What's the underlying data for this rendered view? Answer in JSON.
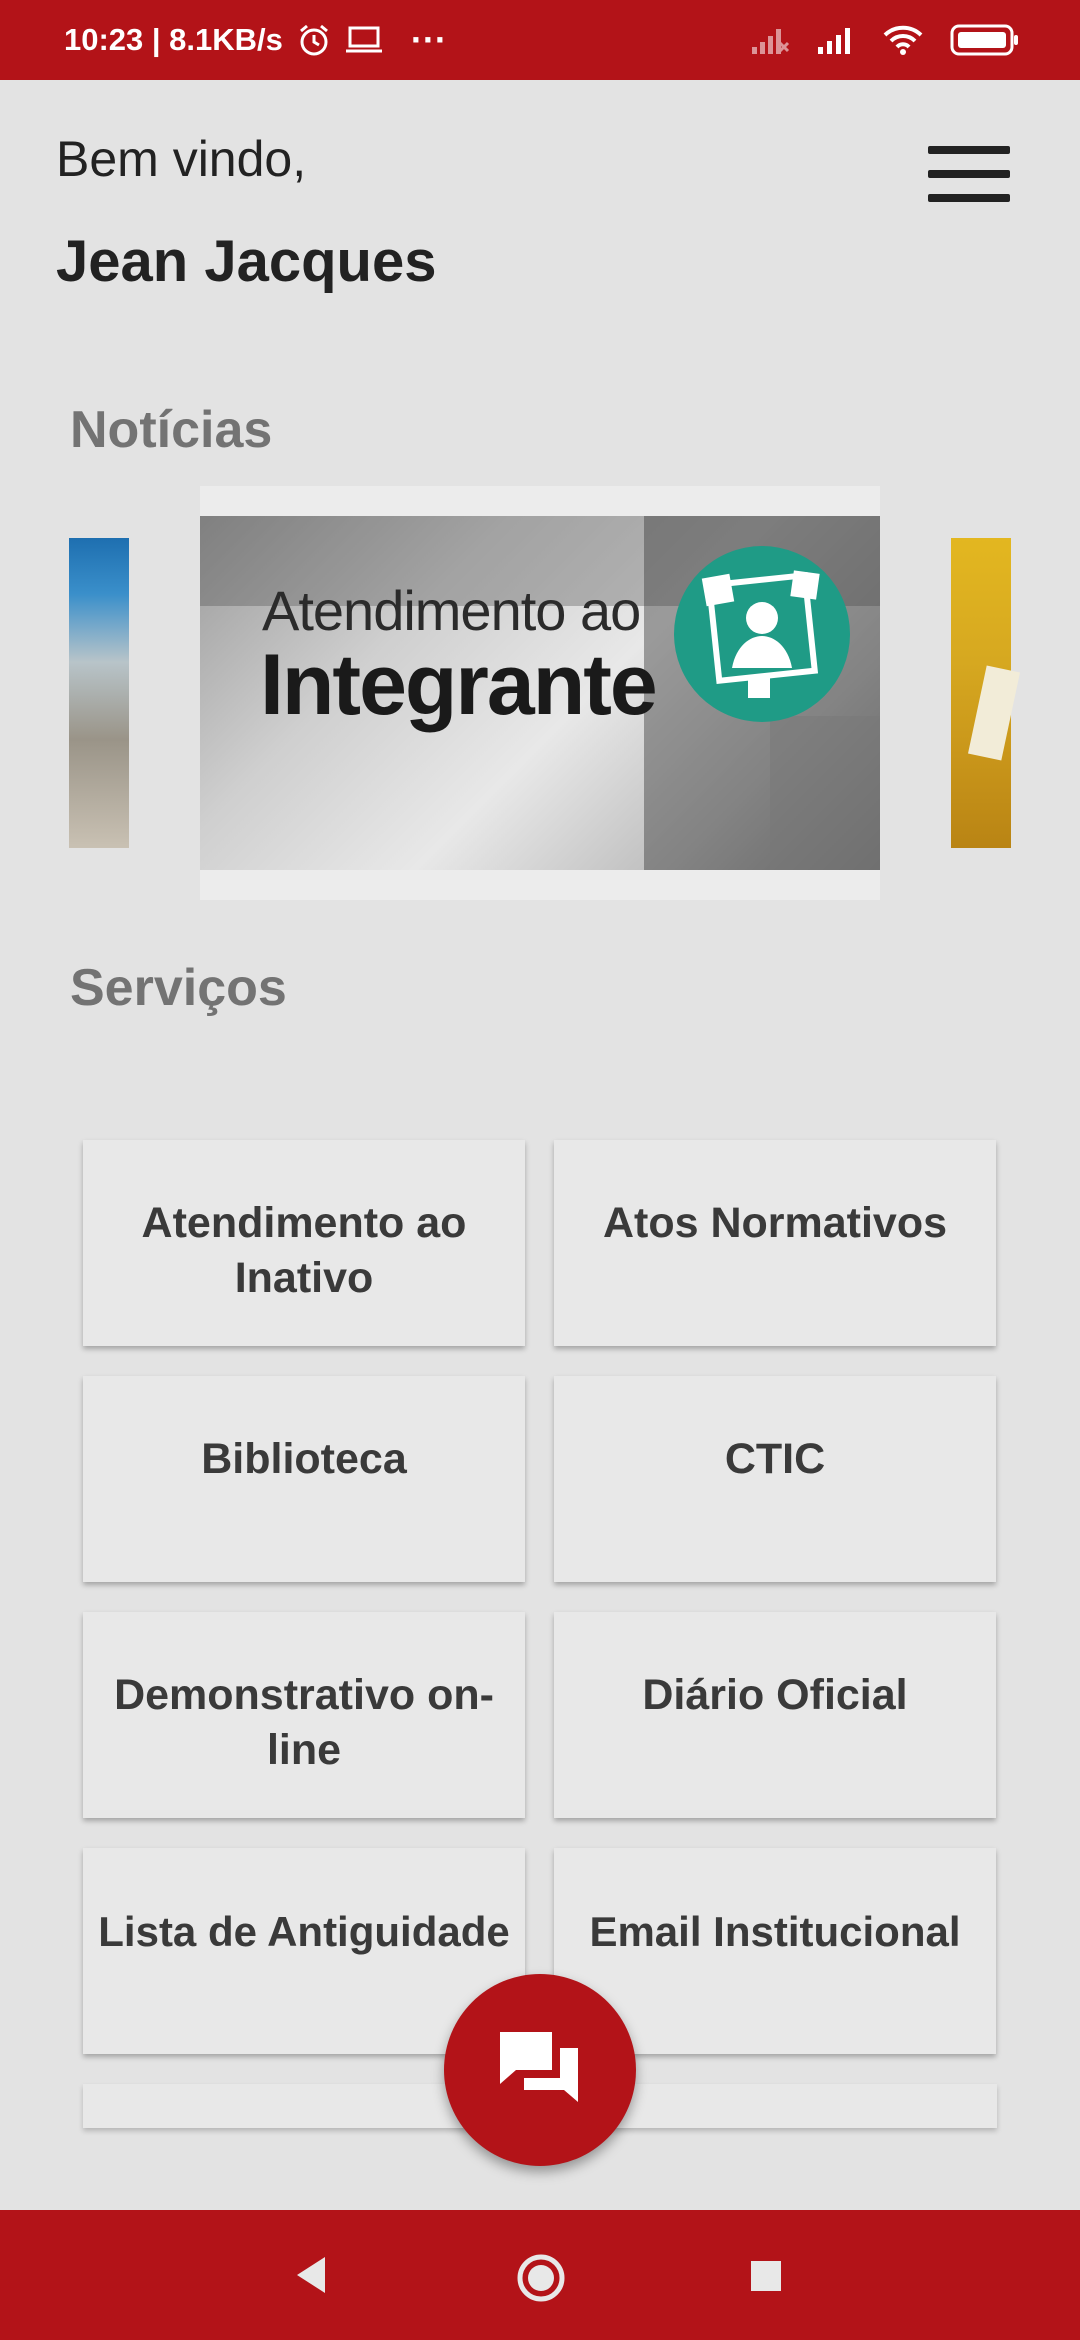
{
  "status_bar": {
    "time_speed": "10:23 | 8.1KB/s",
    "more": "···",
    "icons": [
      "alarm-icon",
      "laptop-icon",
      "signal-off-icon",
      "signal-icon",
      "wifi-icon",
      "battery-icon"
    ]
  },
  "header": {
    "greeting": "Bem vindo,",
    "user_name": "Jean Jacques",
    "menu_icon": "hamburger-menu-icon"
  },
  "news": {
    "title": "Notícias",
    "current_slide": {
      "line1": "Atendimento ao",
      "line2": "Integrante"
    }
  },
  "services": {
    "title": "Serviços",
    "items": [
      {
        "label": "Atendimento ao Inativo"
      },
      {
        "label": "Atos Normativos"
      },
      {
        "label": "Biblioteca"
      },
      {
        "label": "CTIC"
      },
      {
        "label": "Demonstrativo on-line"
      },
      {
        "label": "Diário Oficial"
      },
      {
        "label": "Lista de Antiguidade"
      },
      {
        "label": "Email Institucional"
      }
    ]
  },
  "fab": {
    "icon": "chat-icon"
  },
  "nav": {
    "icons": [
      "back-icon",
      "home-icon",
      "recents-icon"
    ]
  },
  "colors": {
    "primary": "#b31318",
    "background": "#e3e3e3",
    "card": "#e8e8e8",
    "logo_teal": "#1f9b86"
  }
}
